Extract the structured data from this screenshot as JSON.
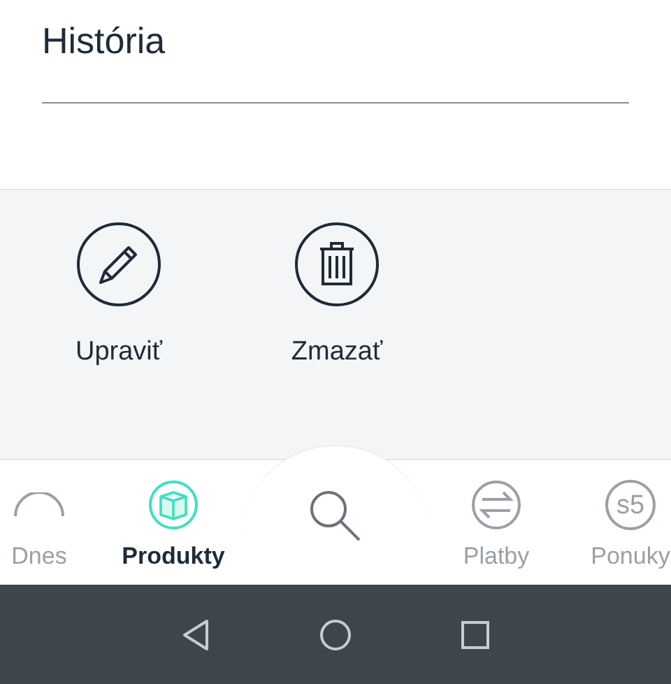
{
  "header": {
    "title": "História"
  },
  "actions": [
    {
      "kind": "edit",
      "label": "Upraviť"
    },
    {
      "kind": "delete",
      "label": "Zmazať"
    }
  ],
  "bottom_nav": [
    {
      "kind": "arc",
      "label": "Dnes",
      "selected": false
    },
    {
      "kind": "box",
      "label": "Produkty",
      "selected": true
    },
    {
      "kind": "search"
    },
    {
      "kind": "transfer",
      "label": "Platby",
      "selected": false
    },
    {
      "kind": "badge",
      "icon_text": "s5",
      "label": "Ponuky",
      "selected": false
    }
  ]
}
